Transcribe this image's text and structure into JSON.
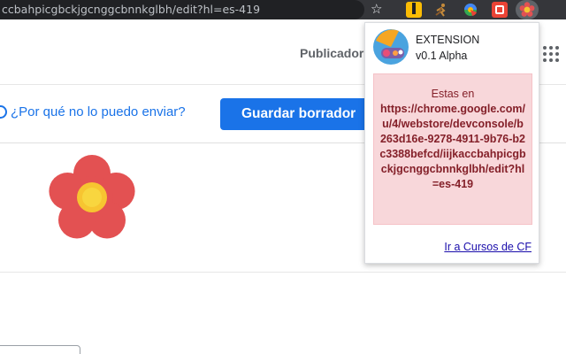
{
  "browser": {
    "url_text": "ccbahpicgbckjgcnggcbnnkglbh/edit?hl=es-419",
    "bookmark_icon": "star-icon",
    "extensions": [
      "tools-extension-icon",
      "runner-extension-icon",
      "colorful-extension-icon",
      "red-box-extension-icon",
      "flower-extension-icon"
    ]
  },
  "page": {
    "publisher_label": "Publicador",
    "help_link": "¿Por qué no lo puedo enviar?",
    "save_draft_button": "Guardar borrador"
  },
  "popup": {
    "name": "EXTENSION",
    "version": "v0.1 Alpha",
    "message_intro": "Estas en",
    "message_url": "https://chrome.google.com/u/4/webstore/devconsole/b263d16e-9278-4911-9b76-b2c3388befcd/iijkaccbahpicgbckjgcnggcbnnkglbh/edit?hl=es-419",
    "footer_link": "Ir a Cursos de CF"
  },
  "colors": {
    "accent": "#1a73e8",
    "alert_bg": "#f8d7da",
    "alert_text": "#842029",
    "flower_petal": "#e35152",
    "flower_center": "#f7c531"
  }
}
